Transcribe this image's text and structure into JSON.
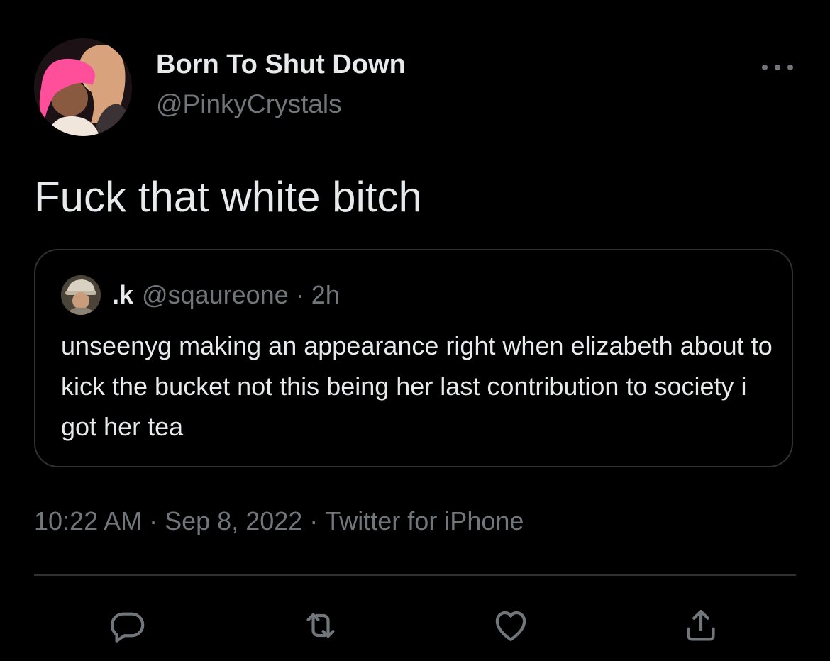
{
  "tweet": {
    "display_name": "Born To Shut Down",
    "handle": "@PinkyCrystals",
    "text": "Fuck that white bitch",
    "more_icon": "ellipsis-icon"
  },
  "quoted_tweet": {
    "display_name": ".k",
    "handle": "@sqaureone",
    "separator": "·",
    "time": "2h",
    "text": "unseenyg making an appearance right when elizabeth about to kick the bucket not this being her last contribution to society i got her tea"
  },
  "meta": {
    "time": "10:22 AM",
    "separator": "·",
    "date": "Sep 8, 2022",
    "source": "Twitter for iPhone"
  },
  "actions": {
    "reply_icon": "reply-icon",
    "retweet_icon": "retweet-icon",
    "like_icon": "heart-icon",
    "share_icon": "share-icon"
  },
  "colors": {
    "background": "#000000",
    "primary_text": "#e7e9ea",
    "secondary_text": "#71767b",
    "border": "#2f3336"
  }
}
